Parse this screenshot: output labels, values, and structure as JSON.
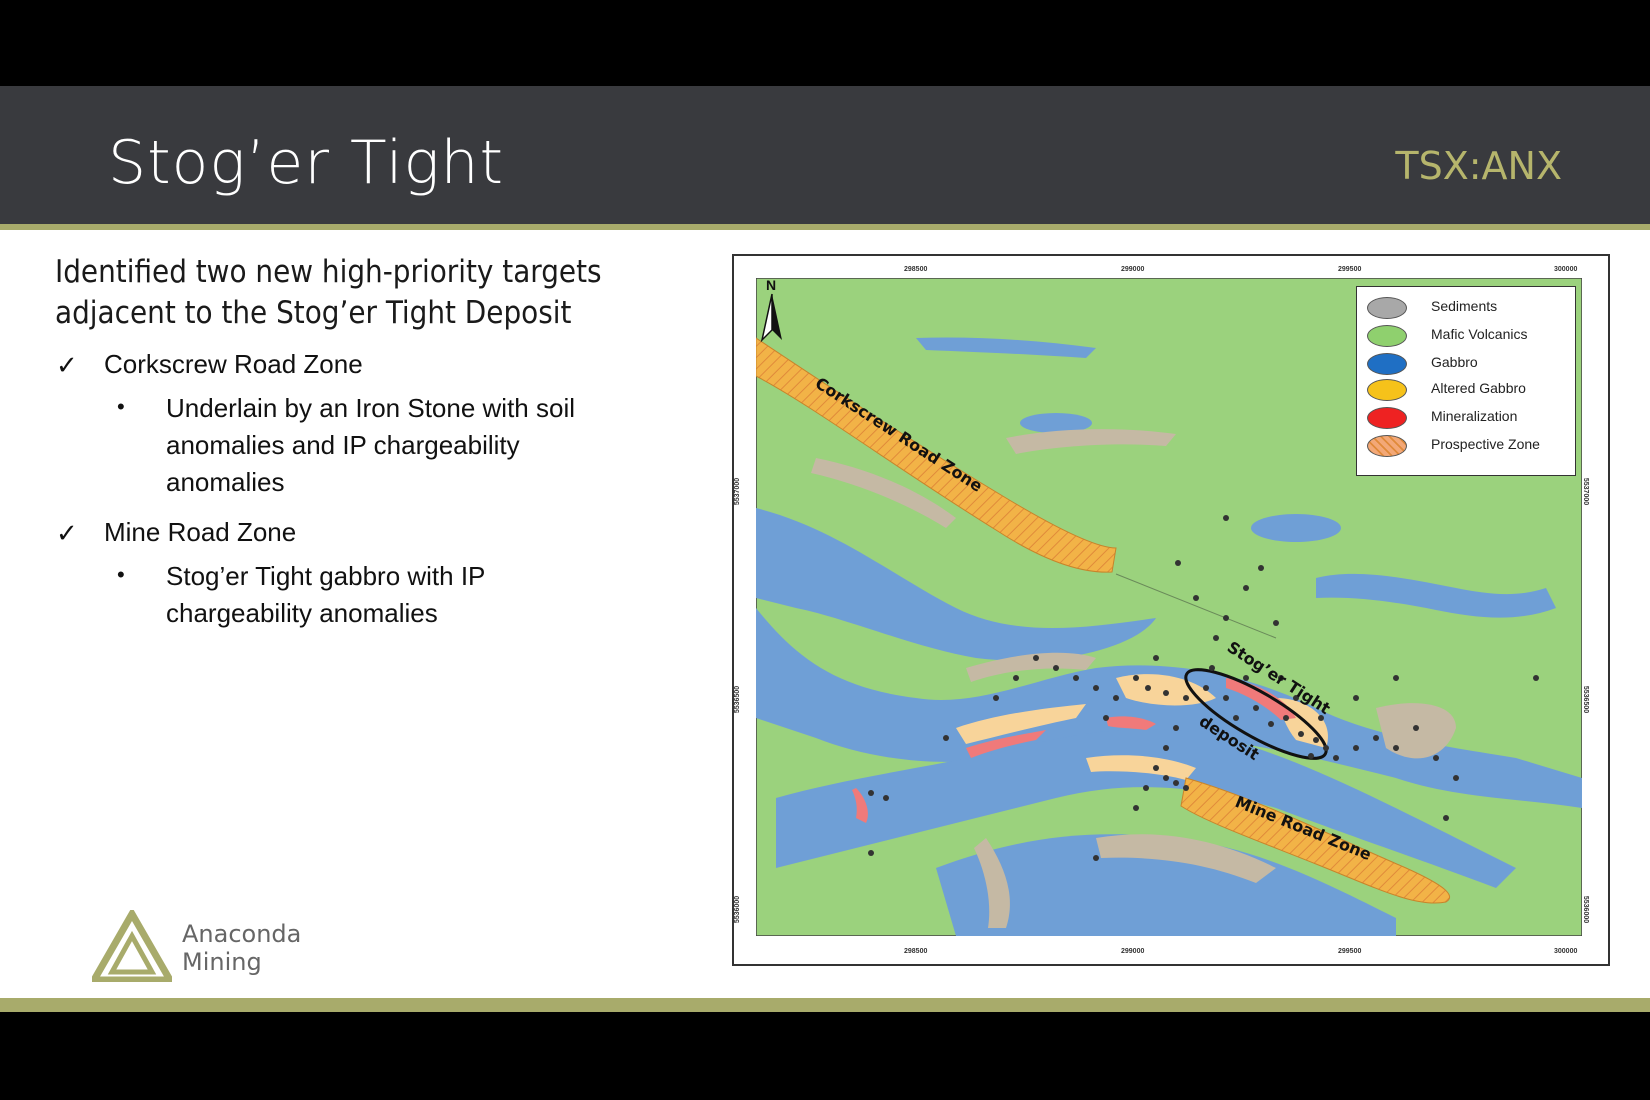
{
  "header": {
    "title": "Stog’er Tight",
    "ticker": "TSX:ANX"
  },
  "content": {
    "heading_line1": "Identified two new high-priority targets",
    "heading_line2": "adjacent to the Stog’er Tight Deposit",
    "check_mark": "✓",
    "bullet_mark": "•",
    "zone1": "Corkscrew Road Zone",
    "zone1_detail_line1": "Underlain by an Iron Stone with soil",
    "zone1_detail_line2": "anomalies and IP chargeability",
    "zone1_detail_line3": "anomalies",
    "zone2": "Mine Road Zone",
    "zone2_detail_line1": "Stog’er Tight gabbro with IP",
    "zone2_detail_line2": "chargeability anomalies"
  },
  "logo": {
    "line1": "Anaconda",
    "line2": "Mining"
  },
  "map": {
    "north": "N",
    "x_ticks": [
      "298500",
      "299000",
      "299500",
      "300000"
    ],
    "y_ticks": [
      "5537000",
      "5536500",
      "5536000"
    ],
    "legend": [
      {
        "label": "Sediments",
        "color": "#a8a8a8"
      },
      {
        "label": "Mafic Volcanics",
        "color": "#8fd06e"
      },
      {
        "label": "Gabbro",
        "color": "#1f6fc4"
      },
      {
        "label": "Altered Gabbro",
        "color": "#f6c21a"
      },
      {
        "label": "Mineralization",
        "color": "#ee2222"
      },
      {
        "label": "Prospective Zone",
        "color": "#f3a877"
      }
    ],
    "labels": {
      "corkscrew": "Corkscrew Road Zone",
      "stoger_line1": "Stog’er Tight",
      "stoger_line2": "deposit",
      "mine_road": "Mine Road Zone"
    },
    "colors": {
      "mafic": "#9bd27d",
      "gabbro": "#6f9fd6",
      "sediments": "#c5b9a4",
      "altered": "#f8d49a",
      "mineral": "#f07a7a",
      "prospective": "#f2b347"
    }
  }
}
